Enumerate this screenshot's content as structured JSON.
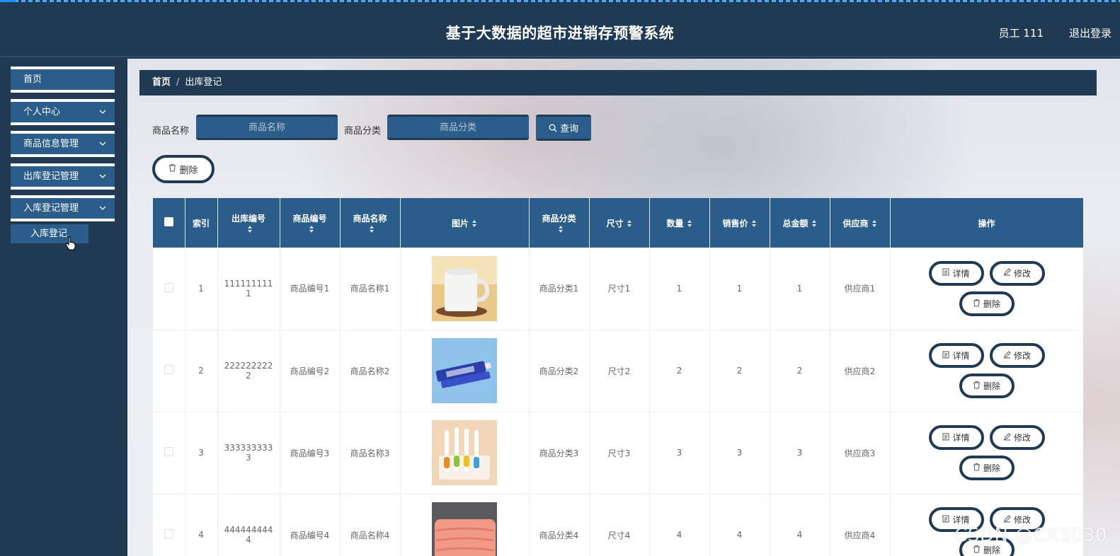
{
  "header": {
    "title": "基于大数据的超市进销存预警系统",
    "user": "员工 111",
    "logout": "退出登录"
  },
  "sidebar": {
    "items": [
      {
        "label": "首页",
        "has_children": false
      },
      {
        "label": "个人中心",
        "has_children": true
      },
      {
        "label": "商品信息管理",
        "has_children": true
      },
      {
        "label": "出库登记管理",
        "has_children": true
      },
      {
        "label": "入库登记管理",
        "has_children": true
      }
    ],
    "submenu": {
      "label": "入库登记"
    }
  },
  "breadcrumb": {
    "home": "首页",
    "separator": "/",
    "current": "出库登记"
  },
  "search": {
    "name_label": "商品名称",
    "name_placeholder": "商品名称",
    "category_label": "商品分类",
    "category_placeholder": "商品分类",
    "query_button": "查询"
  },
  "actions": {
    "bulk_delete": "删除"
  },
  "table": {
    "headers": [
      "索引",
      "出库编号",
      "商品编号",
      "商品名称",
      "图片",
      "商品分类",
      "尺寸",
      "数量",
      "销售价",
      "总金额",
      "供应商",
      "操作"
    ],
    "row_buttons": {
      "detail": "详情",
      "edit": "修改",
      "delete": "删除"
    },
    "rows": [
      {
        "index": "1",
        "out_no": "1111111111",
        "code": "商品编号1",
        "name": "商品名称1",
        "image": "mug",
        "category": "商品分类1",
        "size": "尺寸1",
        "qty": "1",
        "price": "1",
        "total": "1",
        "supplier": "供应商1"
      },
      {
        "index": "2",
        "out_no": "2222222222",
        "code": "商品编号2",
        "name": "商品名称2",
        "image": "toothpaste",
        "category": "商品分类2",
        "size": "尺寸2",
        "qty": "2",
        "price": "2",
        "total": "2",
        "supplier": "供应商2"
      },
      {
        "index": "3",
        "out_no": "3333333333",
        "code": "商品编号3",
        "name": "商品名称3",
        "image": "toothbrushes",
        "category": "商品分类3",
        "size": "尺寸3",
        "qty": "3",
        "price": "3",
        "total": "3",
        "supplier": "供应商3"
      },
      {
        "index": "4",
        "out_no": "4444444444",
        "code": "商品编号4",
        "name": "商品名称4",
        "image": "blanket",
        "category": "商品分类4",
        "size": "尺寸4",
        "qty": "4",
        "price": "4",
        "total": "4",
        "supplier": "供应商4"
      }
    ]
  },
  "watermark": "CSDN @CK3030",
  "colors": {
    "primary": "#1f3a52",
    "accent": "#2a5d8a"
  }
}
